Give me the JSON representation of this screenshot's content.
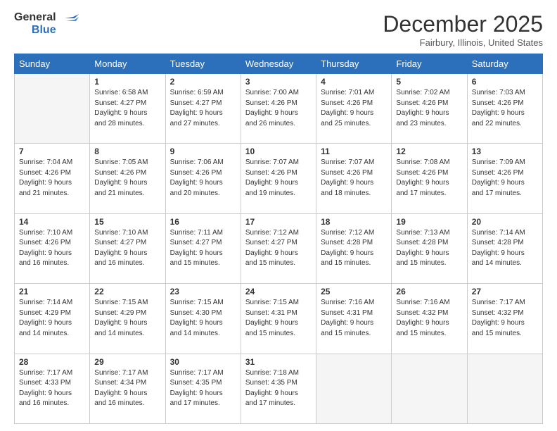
{
  "logo": {
    "line1": "General",
    "line2": "Blue"
  },
  "title": "December 2025",
  "location": "Fairbury, Illinois, United States",
  "days_header": [
    "Sunday",
    "Monday",
    "Tuesday",
    "Wednesday",
    "Thursday",
    "Friday",
    "Saturday"
  ],
  "weeks": [
    [
      {
        "day": "",
        "sunrise": "",
        "sunset": "",
        "daylight": ""
      },
      {
        "day": "1",
        "sunrise": "6:58 AM",
        "sunset": "4:27 PM",
        "daylight": "9 hours and 28 minutes."
      },
      {
        "day": "2",
        "sunrise": "6:59 AM",
        "sunset": "4:27 PM",
        "daylight": "9 hours and 27 minutes."
      },
      {
        "day": "3",
        "sunrise": "7:00 AM",
        "sunset": "4:26 PM",
        "daylight": "9 hours and 26 minutes."
      },
      {
        "day": "4",
        "sunrise": "7:01 AM",
        "sunset": "4:26 PM",
        "daylight": "9 hours and 25 minutes."
      },
      {
        "day": "5",
        "sunrise": "7:02 AM",
        "sunset": "4:26 PM",
        "daylight": "9 hours and 23 minutes."
      },
      {
        "day": "6",
        "sunrise": "7:03 AM",
        "sunset": "4:26 PM",
        "daylight": "9 hours and 22 minutes."
      }
    ],
    [
      {
        "day": "7",
        "sunrise": "7:04 AM",
        "sunset": "4:26 PM",
        "daylight": "9 hours and 21 minutes."
      },
      {
        "day": "8",
        "sunrise": "7:05 AM",
        "sunset": "4:26 PM",
        "daylight": "9 hours and 21 minutes."
      },
      {
        "day": "9",
        "sunrise": "7:06 AM",
        "sunset": "4:26 PM",
        "daylight": "9 hours and 20 minutes."
      },
      {
        "day": "10",
        "sunrise": "7:07 AM",
        "sunset": "4:26 PM",
        "daylight": "9 hours and 19 minutes."
      },
      {
        "day": "11",
        "sunrise": "7:07 AM",
        "sunset": "4:26 PM",
        "daylight": "9 hours and 18 minutes."
      },
      {
        "day": "12",
        "sunrise": "7:08 AM",
        "sunset": "4:26 PM",
        "daylight": "9 hours and 17 minutes."
      },
      {
        "day": "13",
        "sunrise": "7:09 AM",
        "sunset": "4:26 PM",
        "daylight": "9 hours and 17 minutes."
      }
    ],
    [
      {
        "day": "14",
        "sunrise": "7:10 AM",
        "sunset": "4:26 PM",
        "daylight": "9 hours and 16 minutes."
      },
      {
        "day": "15",
        "sunrise": "7:10 AM",
        "sunset": "4:27 PM",
        "daylight": "9 hours and 16 minutes."
      },
      {
        "day": "16",
        "sunrise": "7:11 AM",
        "sunset": "4:27 PM",
        "daylight": "9 hours and 15 minutes."
      },
      {
        "day": "17",
        "sunrise": "7:12 AM",
        "sunset": "4:27 PM",
        "daylight": "9 hours and 15 minutes."
      },
      {
        "day": "18",
        "sunrise": "7:12 AM",
        "sunset": "4:28 PM",
        "daylight": "9 hours and 15 minutes."
      },
      {
        "day": "19",
        "sunrise": "7:13 AM",
        "sunset": "4:28 PM",
        "daylight": "9 hours and 15 minutes."
      },
      {
        "day": "20",
        "sunrise": "7:14 AM",
        "sunset": "4:28 PM",
        "daylight": "9 hours and 14 minutes."
      }
    ],
    [
      {
        "day": "21",
        "sunrise": "7:14 AM",
        "sunset": "4:29 PM",
        "daylight": "9 hours and 14 minutes."
      },
      {
        "day": "22",
        "sunrise": "7:15 AM",
        "sunset": "4:29 PM",
        "daylight": "9 hours and 14 minutes."
      },
      {
        "day": "23",
        "sunrise": "7:15 AM",
        "sunset": "4:30 PM",
        "daylight": "9 hours and 14 minutes."
      },
      {
        "day": "24",
        "sunrise": "7:15 AM",
        "sunset": "4:31 PM",
        "daylight": "9 hours and 15 minutes."
      },
      {
        "day": "25",
        "sunrise": "7:16 AM",
        "sunset": "4:31 PM",
        "daylight": "9 hours and 15 minutes."
      },
      {
        "day": "26",
        "sunrise": "7:16 AM",
        "sunset": "4:32 PM",
        "daylight": "9 hours and 15 minutes."
      },
      {
        "day": "27",
        "sunrise": "7:17 AM",
        "sunset": "4:32 PM",
        "daylight": "9 hours and 15 minutes."
      }
    ],
    [
      {
        "day": "28",
        "sunrise": "7:17 AM",
        "sunset": "4:33 PM",
        "daylight": "9 hours and 16 minutes."
      },
      {
        "day": "29",
        "sunrise": "7:17 AM",
        "sunset": "4:34 PM",
        "daylight": "9 hours and 16 minutes."
      },
      {
        "day": "30",
        "sunrise": "7:17 AM",
        "sunset": "4:35 PM",
        "daylight": "9 hours and 17 minutes."
      },
      {
        "day": "31",
        "sunrise": "7:18 AM",
        "sunset": "4:35 PM",
        "daylight": "9 hours and 17 minutes."
      },
      {
        "day": "",
        "sunrise": "",
        "sunset": "",
        "daylight": ""
      },
      {
        "day": "",
        "sunrise": "",
        "sunset": "",
        "daylight": ""
      },
      {
        "day": "",
        "sunrise": "",
        "sunset": "",
        "daylight": ""
      }
    ]
  ],
  "labels": {
    "sunrise": "Sunrise:",
    "sunset": "Sunset:",
    "daylight": "Daylight:"
  }
}
